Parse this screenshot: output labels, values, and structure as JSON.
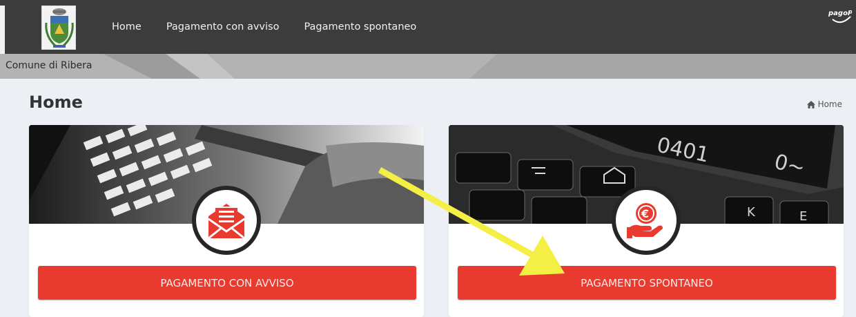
{
  "navbar": {
    "items": [
      {
        "label": "Home"
      },
      {
        "label": "Pagamento con avviso"
      },
      {
        "label": "Pagamento spontaneo"
      }
    ],
    "pagopa_label": "pagoPA"
  },
  "municipality": {
    "name": "Comune di Ribera"
  },
  "page": {
    "title": "Home"
  },
  "breadcrumb": {
    "icon": "home-icon",
    "label": "Home"
  },
  "cards": [
    {
      "icon": "envelope-invoice-icon",
      "button_label": "PAGAMENTO CON AVVISO"
    },
    {
      "icon": "hand-euro-coin-icon",
      "button_label": "PAGAMENTO SPONTANEO"
    }
  ],
  "colors": {
    "accent": "#e83a2e",
    "navbar": "#3c3c3c",
    "annotation_arrow": "#f4ef45"
  }
}
